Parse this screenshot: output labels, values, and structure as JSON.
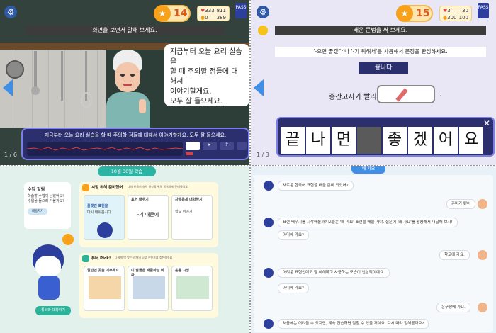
{
  "top_id": "000001000000",
  "q1": {
    "coins": "14",
    "stats": [
      "333",
      "0",
      "811",
      "389"
    ],
    "badge": "PASS",
    "banner": "화면을 보면서 말해 보세요.",
    "speech": [
      "지금부터 오늘 요리 실습을",
      "할 때 주의할 점들에 대해서",
      "이야기할게요.",
      "모두 잘 들으세요."
    ],
    "subtitle": "지금부터 오늘 요리 실습을 할 때 주의할 점들에 대해서 이야기할게요. 모두 잘 들으세요.",
    "page": "1 / 6"
  },
  "q2": {
    "coins": "15",
    "stats": [
      "3",
      "300",
      "30",
      "100"
    ],
    "badge": "PASS",
    "banner": "배운 문법을 써 보세요.",
    "instruction": "'-으면 좋겠다'나 '-기 위해서'를 사용해서 문장을 완성하세요.",
    "answer_label": "끝나다",
    "sentence": "중간고사가 빨리",
    "period": ".",
    "chars": [
      "끝",
      "나",
      "면",
      "",
      "좋",
      "겠",
      "어",
      "요"
    ],
    "close": "✕",
    "page": "1 / 3"
  },
  "q3": {
    "date_tab": "10월 30일 학습",
    "alarm_title": "수업 알림",
    "alarm_text": "학습할 수업이 남았어요! 수업을 들으러 가볼까요?",
    "alarm_button": "배움지기",
    "section1_title": "시험 위해 준비했어",
    "section1_sub": "나의 한국어 실력 향상을 위해 꼼꼼하게 준비했어요!",
    "cards1": [
      {
        "title": "플랫인 표현을",
        "sub": "다시 배워봅시다"
      },
      {
        "title": "표현 배우기",
        "sub": "-기 때문에"
      },
      {
        "title": "자유롭게 대화하기",
        "sub": "학교 이야기"
      }
    ],
    "section2_title": "튜터 Pick!",
    "section2_sub": "나에게 딱 맞는 레벨의 공부 콘텐츠를 추천해줘요",
    "cards2": [
      {
        "title": "일반인 곳을 기부해요"
      },
      {
        "title": "이 팔들은 재활하는 비싸"
      },
      {
        "title": "운동 시장"
      }
    ],
    "chat_button": "튜터와 대화하기"
  },
  "q4": {
    "title": "왜 가요",
    "messages": [
      {
        "side": "left",
        "text": "새로운 한국어 표현을 배울 준비 되었어?"
      },
      {
        "side": "right",
        "text": "준비가 됐어"
      },
      {
        "side": "left",
        "text": "표현 배우기를 시작해볼까? 오늘은 '왜 가요' 표현을 배울 거야. 질문에 '왜 가요'를 활용해서 대답해 보자!"
      },
      {
        "side": "left",
        "text": "어디에 가요?"
      },
      {
        "side": "right",
        "text": "학교에 가요."
      },
      {
        "side": "left",
        "text": "어려운 표현인데도 잘 이해하고 사용하는 모습이 인상적이에요."
      },
      {
        "side": "left",
        "text": "어디에 가요?"
      },
      {
        "side": "right",
        "text": "운구장에 가요."
      },
      {
        "side": "left",
        "text": "처음에는 어려울 수 있지만, 계속 연습하면 잘할 수 있을 거예요. 다시 따라 말해볼까요?"
      }
    ]
  },
  "colors": {
    "accent": "#7d7fe8",
    "coin": "#f7a21a",
    "badge": "#2c3f9c",
    "banner": "#3c3c3c"
  }
}
